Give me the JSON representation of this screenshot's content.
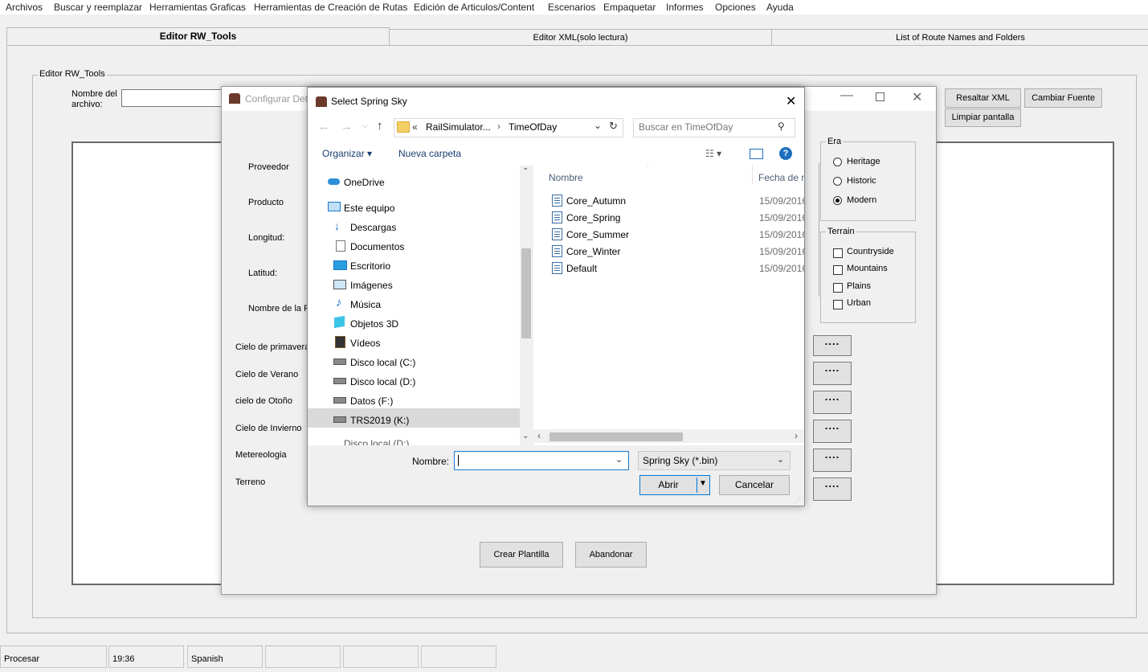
{
  "menu": [
    "Archivos",
    "Buscar y reemplazar",
    "Herramientas Graficas",
    "Herramientas de Creación de Rutas",
    "Edición de Articulos/Content",
    "Escenarios",
    "Empaquetar",
    "Informes",
    "Opciones",
    "Ayuda"
  ],
  "tabs": [
    "Editor RW_Tools",
    "Editor XML(solo lectura)",
    "List of Route Names and Folders"
  ],
  "editor": {
    "group_label": "Editor RW_Tools",
    "filename_label_1": "Nombre del",
    "filename_label_2": "archivo:",
    "highlight_button": "Resaltar XML",
    "font_button": "Cambiar Fuente",
    "clear_button": "Limpiar pantalla"
  },
  "config_dialog": {
    "title": "Configurar Det",
    "labels": [
      "Proveedor",
      "Producto",
      "Longitud:",
      "Latitud:",
      "Nombre de la Pl"
    ],
    "sky_labels": [
      "Cielo de primavera",
      "Cielo de Verano",
      "cielo de Otoño",
      "Cielo de Invierno",
      "Metereologia",
      "Terreno"
    ],
    "dots_label": "....",
    "era": {
      "label": "Era",
      "options": [
        "Heritage",
        "Historic",
        "Modern"
      ],
      "selected": "Modern"
    },
    "terrain": {
      "label": "Terrain",
      "options": [
        "Countryside",
        "Mountains",
        "Plains",
        "Urban"
      ]
    },
    "create_button": "Crear Plantilla",
    "abandon_button": "Abandonar"
  },
  "file_dialog": {
    "title": "Select Spring Sky",
    "path_prefix": "«",
    "path_parent": "RailSimulator...",
    "path_current": "TimeOfDay",
    "search_placeholder": "Buscar en TimeOfDay",
    "organize": "Organizar",
    "new_folder": "Nueva carpeta",
    "nav": [
      {
        "label": "OneDrive",
        "icon": "onedrive-icon"
      },
      {
        "label": "Este equipo",
        "icon": "computer-icon"
      },
      {
        "label": "Descargas",
        "icon": "downloads-icon"
      },
      {
        "label": "Documentos",
        "icon": "documents-icon"
      },
      {
        "label": "Escritorio",
        "icon": "desktop-icon"
      },
      {
        "label": "Imágenes",
        "icon": "pictures-icon"
      },
      {
        "label": "Música",
        "icon": "music-icon"
      },
      {
        "label": "Objetos 3D",
        "icon": "3d-objects-icon"
      },
      {
        "label": "Vídeos",
        "icon": "videos-icon"
      },
      {
        "label": "Disco local (C:)",
        "icon": "drive-icon"
      },
      {
        "label": "Disco local (D:)",
        "icon": "drive-icon"
      },
      {
        "label": "Datos (F:)",
        "icon": "drive-icon"
      },
      {
        "label": "TRS2019 (K:)",
        "icon": "drive-icon"
      },
      {
        "label": "Disco local (D:)",
        "icon": "drive-icon"
      }
    ],
    "col_name": "Nombre",
    "col_date": "Fecha de m",
    "files": [
      {
        "name": "Core_Autumn",
        "date": "15/09/2016"
      },
      {
        "name": "Core_Spring",
        "date": "15/09/2016"
      },
      {
        "name": "Core_Summer",
        "date": "15/09/2016"
      },
      {
        "name": "Core_Winter",
        "date": "15/09/2016"
      },
      {
        "name": "Default",
        "date": "15/09/2016"
      }
    ],
    "filename_label": "Nombre:",
    "filename_value": "",
    "filter": "Spring Sky (*.bin)",
    "open_button": "Abrir",
    "cancel_button": "Cancelar"
  },
  "status": [
    "Procesar",
    "19:36",
    "Spanish",
    "",
    "",
    ""
  ]
}
